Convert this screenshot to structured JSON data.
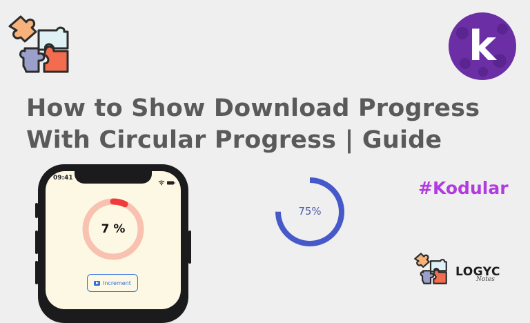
{
  "title": {
    "line1": "How to Show Download Progress",
    "line2": "With Circular Progress | Guide"
  },
  "hashtag": "#Kodular",
  "phone": {
    "status_time": "09:41",
    "progress_label": "7 %",
    "progress_fraction": 0.07,
    "button_label": "Increment",
    "button_icon": "play-icon"
  },
  "demo_progress": {
    "label": "75%",
    "fraction": 0.75
  },
  "brand": {
    "kodular_letter": "k",
    "logyc_label": "LOGYC",
    "notes_label": "Notes"
  },
  "colors": {
    "background": "#efefef",
    "title": "#5a5a5a",
    "hashtag": "#b13be0",
    "ring_track": "#f8c1b0",
    "ring_progress": "#ef3b3b",
    "demo_ring": "#4759c9",
    "kodular_purple": "#6b2ea5",
    "button_blue": "#2f6fde"
  }
}
